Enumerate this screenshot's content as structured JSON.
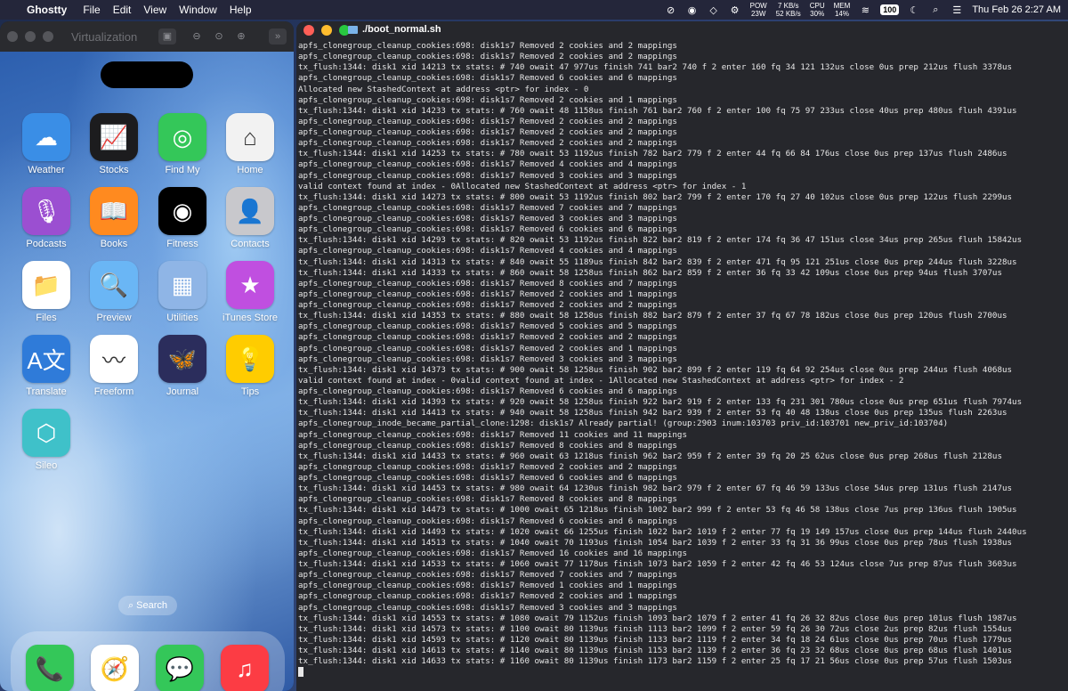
{
  "menubar": {
    "apple_icon": "apple-icon",
    "app_name": "Ghostty",
    "menus": [
      "File",
      "Edit",
      "View",
      "Window",
      "Help"
    ],
    "pow_label": "POW",
    "pow_value": "23W",
    "net_up": "7 KB/s",
    "net_down": "52 KB/s",
    "cpu_label": "CPU",
    "cpu_value": "30%",
    "mem_label": "MEM",
    "mem_value": "14%",
    "battery": "100",
    "clock": "Thu Feb 26  2:27 AM"
  },
  "vm": {
    "title": "Virtualization",
    "search_label": "Search",
    "apps": [
      {
        "label": "Weather",
        "icon": "weather-icon",
        "color": "#3a8ee6",
        "glyph": "☁"
      },
      {
        "label": "Stocks",
        "icon": "stocks-icon",
        "color": "#1c1c1e",
        "glyph": "📈"
      },
      {
        "label": "Find My",
        "icon": "findmy-icon",
        "color": "#34c759",
        "glyph": "◎"
      },
      {
        "label": "Home",
        "icon": "home-icon",
        "color": "#f2f2f2",
        "glyph": "⌂"
      },
      {
        "label": "Podcasts",
        "icon": "podcasts-icon",
        "color": "#9b4fd1",
        "glyph": "🎙"
      },
      {
        "label": "Books",
        "icon": "books-icon",
        "color": "#ff8a1f",
        "glyph": "📖"
      },
      {
        "label": "Fitness",
        "icon": "fitness-icon",
        "color": "#000000",
        "glyph": "◉"
      },
      {
        "label": "Contacts",
        "icon": "contacts-icon",
        "color": "#c8c8cc",
        "glyph": "👤"
      },
      {
        "label": "Files",
        "icon": "files-icon",
        "color": "#ffffff",
        "glyph": "📁"
      },
      {
        "label": "Preview",
        "icon": "preview-icon",
        "color": "#6ab6f5",
        "glyph": "🔍"
      },
      {
        "label": "Utilities",
        "icon": "utilities-folder-icon",
        "color": "#8fb5e6",
        "glyph": "▦"
      },
      {
        "label": "iTunes Store",
        "icon": "itunes-store-icon",
        "color": "#c04fe0",
        "glyph": "★"
      },
      {
        "label": "Translate",
        "icon": "translate-icon",
        "color": "#2f7bd9",
        "glyph": "A文"
      },
      {
        "label": "Freeform",
        "icon": "freeform-icon",
        "color": "#ffffff",
        "glyph": "〰"
      },
      {
        "label": "Journal",
        "icon": "journal-icon",
        "color": "#2b2d5c",
        "glyph": "🦋"
      },
      {
        "label": "Tips",
        "icon": "tips-icon",
        "color": "#ffcc00",
        "glyph": "💡"
      },
      {
        "label": "Sileo",
        "icon": "sileo-icon",
        "color": "#3fc1c9",
        "glyph": "⬡"
      }
    ],
    "dock": [
      {
        "name": "phone",
        "icon": "phone-icon",
        "color": "#34c759",
        "glyph": "📞"
      },
      {
        "name": "safari",
        "icon": "safari-icon",
        "color": "#ffffff",
        "glyph": "🧭"
      },
      {
        "name": "messages",
        "icon": "messages-icon",
        "color": "#34c759",
        "glyph": "💬"
      },
      {
        "name": "music",
        "icon": "music-icon",
        "color": "#fc3c44",
        "glyph": "♫"
      }
    ]
  },
  "terminal": {
    "title": "./boot_normal.sh",
    "lines": [
      "apfs_clonegroup_cleanup_cookies:698: disk1s7 Removed 2 cookies and 2 mappings",
      "apfs_clonegroup_cleanup_cookies:698: disk1s7 Removed 2 cookies and 2 mappings",
      "tx_flush:1344: disk1 xid 14213 tx stats: # 740 owait 47 977us finish 741 bar2 740 f 2 enter 160 fq 34 121 132us close 0us prep 212us flush 3378us",
      "apfs_clonegroup_cleanup_cookies:698: disk1s7 Removed 6 cookies and 6 mappings",
      "Allocated new StashedContext at address <ptr> for index - 0",
      "apfs_clonegroup_cleanup_cookies:698: disk1s7 Removed 2 cookies and 1 mappings",
      "tx_flush:1344: disk1 xid 14233 tx stats: # 760 owait 48 1158us finish 761 bar2 760 f 2 enter 100 fq 75 97 233us close 40us prep 480us flush 4391us",
      "apfs_clonegroup_cleanup_cookies:698: disk1s7 Removed 2 cookies and 2 mappings",
      "apfs_clonegroup_cleanup_cookies:698: disk1s7 Removed 2 cookies and 2 mappings",
      "apfs_clonegroup_cleanup_cookies:698: disk1s7 Removed 2 cookies and 2 mappings",
      "tx_flush:1344: disk1 xid 14253 tx stats: # 780 owait 53 1192us finish 782 bar2 779 f 2 enter 44 fq 66 84 176us close 0us prep 137us flush 2486us",
      "apfs_clonegroup_cleanup_cookies:698: disk1s7 Removed 4 cookies and 4 mappings",
      "apfs_clonegroup_cleanup_cookies:698: disk1s7 Removed 3 cookies and 3 mappings",
      "valid context found at index - 0Allocated new StashedContext at address <ptr> for index - 1",
      "tx_flush:1344: disk1 xid 14273 tx stats: # 800 owait 53 1192us finish 802 bar2 799 f 2 enter 170 fq 27 40 102us close 0us prep 122us flush 2299us",
      "apfs_clonegroup_cleanup_cookies:698: disk1s7 Removed 7 cookies and 7 mappings",
      "apfs_clonegroup_cleanup_cookies:698: disk1s7 Removed 3 cookies and 3 mappings",
      "apfs_clonegroup_cleanup_cookies:698: disk1s7 Removed 6 cookies and 6 mappings",
      "tx_flush:1344: disk1 xid 14293 tx stats: # 820 owait 53 1192us finish 822 bar2 819 f 2 enter 174 fq 36 47 151us close 34us prep 265us flush 15842us",
      "apfs_clonegroup_cleanup_cookies:698: disk1s7 Removed 4 cookies and 4 mappings",
      "tx_flush:1344: disk1 xid 14313 tx stats: # 840 owait 55 1189us finish 842 bar2 839 f 2 enter 471 fq 95 121 251us close 0us prep 244us flush 3228us",
      "tx_flush:1344: disk1 xid 14333 tx stats: # 860 owait 58 1258us finish 862 bar2 859 f 2 enter 36 fq 33 42 109us close 0us prep 94us flush 3707us",
      "apfs_clonegroup_cleanup_cookies:698: disk1s7 Removed 8 cookies and 7 mappings",
      "apfs_clonegroup_cleanup_cookies:698: disk1s7 Removed 2 cookies and 1 mappings",
      "apfs_clonegroup_cleanup_cookies:698: disk1s7 Removed 2 cookies and 2 mappings",
      "tx_flush:1344: disk1 xid 14353 tx stats: # 880 owait 58 1258us finish 882 bar2 879 f 2 enter 37 fq 67 78 182us close 0us prep 120us flush 2700us",
      "apfs_clonegroup_cleanup_cookies:698: disk1s7 Removed 5 cookies and 5 mappings",
      "apfs_clonegroup_cleanup_cookies:698: disk1s7 Removed 2 cookies and 2 mappings",
      "apfs_clonegroup_cleanup_cookies:698: disk1s7 Removed 2 cookies and 1 mappings",
      "apfs_clonegroup_cleanup_cookies:698: disk1s7 Removed 3 cookies and 3 mappings",
      "tx_flush:1344: disk1 xid 14373 tx stats: # 900 owait 58 1258us finish 902 bar2 899 f 2 enter 119 fq 64 92 254us close 0us prep 244us flush 4068us",
      "valid context found at index - 0valid context found at index - 1Allocated new StashedContext at address <ptr> for index - 2",
      "apfs_clonegroup_cleanup_cookies:698: disk1s7 Removed 6 cookies and 6 mappings",
      "tx_flush:1344: disk1 xid 14393 tx stats: # 920 owait 58 1258us finish 922 bar2 919 f 2 enter 133 fq 231 301 780us close 0us prep 651us flush 7974us",
      "tx_flush:1344: disk1 xid 14413 tx stats: # 940 owait 58 1258us finish 942 bar2 939 f 2 enter 53 fq 40 48 138us close 0us prep 135us flush 2263us",
      "apfs_clonegroup_inode_became_partial_clone:1298: disk1s7 Already partial! (group:2903 inum:103703 priv_id:103701 new_priv_id:103704)",
      "apfs_clonegroup_cleanup_cookies:698: disk1s7 Removed 11 cookies and 11 mappings",
      "apfs_clonegroup_cleanup_cookies:698: disk1s7 Removed 8 cookies and 8 mappings",
      "tx_flush:1344: disk1 xid 14433 tx stats: # 960 owait 63 1218us finish 962 bar2 959 f 2 enter 39 fq 20 25 62us close 0us prep 268us flush 2128us",
      "apfs_clonegroup_cleanup_cookies:698: disk1s7 Removed 2 cookies and 2 mappings",
      "apfs_clonegroup_cleanup_cookies:698: disk1s7 Removed 6 cookies and 6 mappings",
      "tx_flush:1344: disk1 xid 14453 tx stats: # 980 owait 64 1230us finish 982 bar2 979 f 2 enter 67 fq 46 59 133us close 54us prep 131us flush 2147us",
      "apfs_clonegroup_cleanup_cookies:698: disk1s7 Removed 8 cookies and 8 mappings",
      "tx_flush:1344: disk1 xid 14473 tx stats: # 1000 owait 65 1218us finish 1002 bar2 999 f 2 enter 53 fq 46 58 138us close 7us prep 136us flush 1905us",
      "apfs_clonegroup_cleanup_cookies:698: disk1s7 Removed 6 cookies and 6 mappings",
      "tx_flush:1344: disk1 xid 14493 tx stats: # 1020 owait 66 1255us finish 1022 bar2 1019 f 2 enter 77 fq 19 149 157us close 0us prep 144us flush 2440us",
      "tx_flush:1344: disk1 xid 14513 tx stats: # 1040 owait 70 1193us finish 1054 bar2 1039 f 2 enter 33 fq 31 36 99us close 0us prep 78us flush 1938us",
      "apfs_clonegroup_cleanup_cookies:698: disk1s7 Removed 16 cookies and 16 mappings",
      "tx_flush:1344: disk1 xid 14533 tx stats: # 1060 owait 77 1178us finish 1073 bar2 1059 f 2 enter 42 fq 46 53 124us close 7us prep 87us flush 3603us",
      "apfs_clonegroup_cleanup_cookies:698: disk1s7 Removed 7 cookies and 7 mappings",
      "apfs_clonegroup_cleanup_cookies:698: disk1s7 Removed 1 cookies and 1 mappings",
      "apfs_clonegroup_cleanup_cookies:698: disk1s7 Removed 2 cookies and 1 mappings",
      "apfs_clonegroup_cleanup_cookies:698: disk1s7 Removed 3 cookies and 3 mappings",
      "tx_flush:1344: disk1 xid 14553 tx stats: # 1080 owait 79 1152us finish 1093 bar2 1079 f 2 enter 41 fq 26 32 82us close 0us prep 101us flush 1987us",
      "tx_flush:1344: disk1 xid 14573 tx stats: # 1100 owait 80 1139us finish 1113 bar2 1099 f 2 enter 59 fq 26 30 72us close 2us prep 82us flush 1554us",
      "tx_flush:1344: disk1 xid 14593 tx stats: # 1120 owait 80 1139us finish 1133 bar2 1119 f 2 enter 34 fq 18 24 61us close 0us prep 70us flush 1779us",
      "tx_flush:1344: disk1 xid 14613 tx stats: # 1140 owait 80 1139us finish 1153 bar2 1139 f 2 enter 36 fq 23 32 68us close 0us prep 68us flush 1401us",
      "tx_flush:1344: disk1 xid 14633 tx stats: # 1160 owait 80 1139us finish 1173 bar2 1159 f 2 enter 25 fq 17 21 56us close 0us prep 57us flush 1503us"
    ]
  }
}
